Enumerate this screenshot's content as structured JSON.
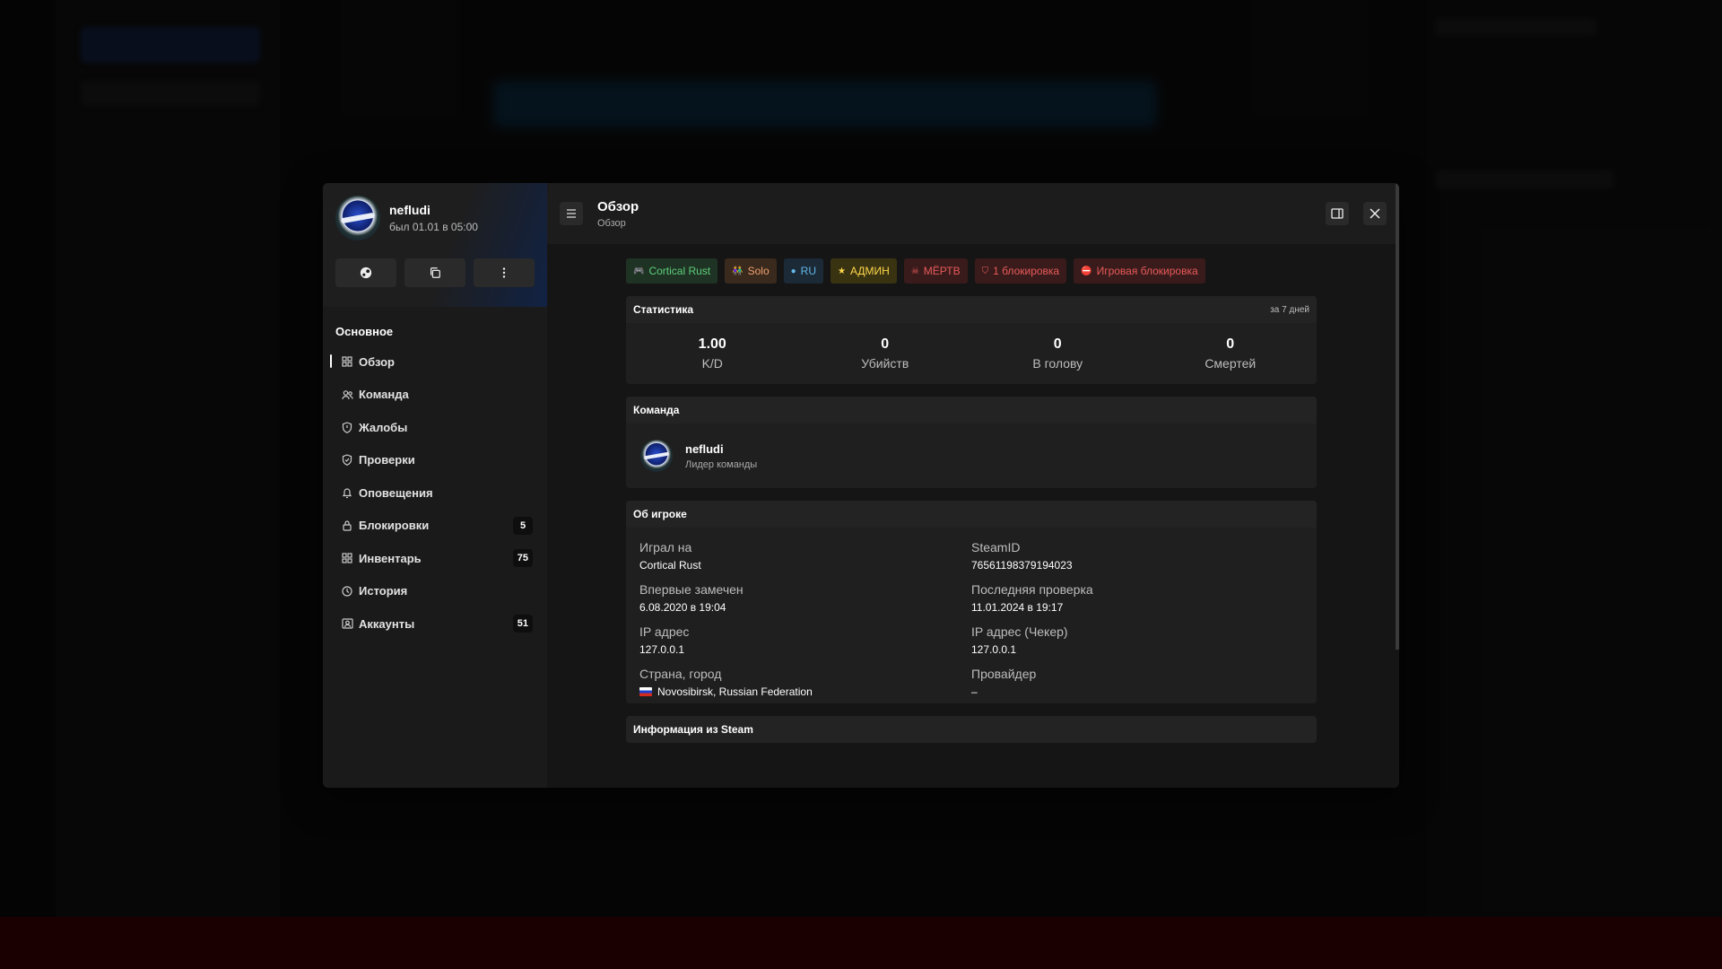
{
  "profile": {
    "username": "nefludi",
    "last_seen": "был 01.01 в 05:00"
  },
  "sidebar": {
    "section_title": "Основное",
    "items": [
      {
        "label": "Обзор",
        "icon": "grid-icon",
        "badge": ""
      },
      {
        "label": "Команда",
        "icon": "users-icon",
        "badge": ""
      },
      {
        "label": "Жалобы",
        "icon": "shield-icon",
        "badge": ""
      },
      {
        "label": "Проверки",
        "icon": "shield-check-icon",
        "badge": ""
      },
      {
        "label": "Оповещения",
        "icon": "bell-icon",
        "badge": ""
      },
      {
        "label": "Блокировки",
        "icon": "lock-icon",
        "badge": "5"
      },
      {
        "label": "Инвентарь",
        "icon": "grid-icon",
        "badge": "75"
      },
      {
        "label": "История",
        "icon": "clock-icon",
        "badge": ""
      },
      {
        "label": "Аккаунты",
        "icon": "user-group-icon",
        "badge": "51"
      }
    ]
  },
  "header": {
    "title": "Обзор",
    "subtitle": "Обзор"
  },
  "chips": [
    {
      "label": "Cortical Rust",
      "icon": "gamepad-icon",
      "color": "#5ecf7a",
      "bg": "#1f3325"
    },
    {
      "label": "Solo",
      "icon": "people-icon",
      "color": "#f0a070",
      "bg": "#3a2a1d"
    },
    {
      "label": "RU",
      "icon": "globe-icon",
      "color": "#63b8e8",
      "bg": "#1b2a36"
    },
    {
      "label": "АДМИН",
      "icon": "star-icon",
      "color": "#ffd84a",
      "bg": "#3a3312"
    },
    {
      "label": "МЁРТВ",
      "icon": "skull-icon",
      "color": "#e85a5a",
      "bg": "#3a1b1b"
    },
    {
      "label": "1 блокировка",
      "icon": "shield-icon",
      "color": "#e85a5a",
      "bg": "#3a1b1b"
    },
    {
      "label": "Игровая блокировка",
      "icon": "ban-icon",
      "color": "#e85a5a",
      "bg": "#3a1b1b"
    }
  ],
  "stats": {
    "title": "Статистика",
    "period": "за 7 дней",
    "items": [
      {
        "value": "1.00",
        "label": "K/D"
      },
      {
        "value": "0",
        "label": "Убийств"
      },
      {
        "value": "0",
        "label": "В голову"
      },
      {
        "value": "0",
        "label": "Смертей"
      }
    ]
  },
  "team": {
    "title": "Команда",
    "member_name": "nefludi",
    "member_role": "Лидер команды"
  },
  "about": {
    "title": "Об игроке",
    "fields": [
      {
        "label": "Играл на",
        "value": "Cortical Rust"
      },
      {
        "label": "SteamID",
        "value": "76561198379194023"
      },
      {
        "label": "Впервые замечен",
        "value": "6.08.2020 в 19:04"
      },
      {
        "label": "Последняя проверка",
        "value": "11.01.2024 в 19:17"
      },
      {
        "label": "IP адрес",
        "value": "127.0.0.1"
      },
      {
        "label": "IP адрес (Чекер)",
        "value": "127.0.0.1"
      },
      {
        "label": "Страна, город",
        "value": "Novosibirsk, Russian Federation"
      },
      {
        "label": "Провайдер",
        "value": "–"
      }
    ]
  },
  "steam": {
    "title": "Информация из Steam"
  }
}
